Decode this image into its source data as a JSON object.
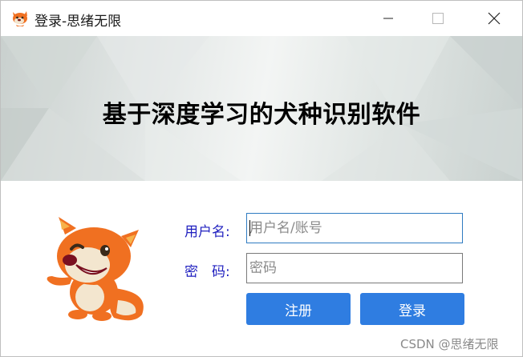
{
  "window": {
    "title": "登录-思绪无限",
    "icon": "squirrel-mascot-icon",
    "controls": [
      "minimize-icon",
      "maximize-icon",
      "close-icon"
    ]
  },
  "banner": {
    "title": "基于深度学习的犬种识别软件"
  },
  "form": {
    "username_label": "用户名:",
    "username_placeholder": "用户名/账号",
    "password_label": "密　码:",
    "password_placeholder": "密码"
  },
  "buttons": {
    "register": "注册",
    "login": "登录"
  },
  "watermark": "CSDN @思绪无限",
  "colors": {
    "accent": "#2f7de1",
    "label": "#1f1fbf",
    "mascot_orange": "#f07021"
  }
}
